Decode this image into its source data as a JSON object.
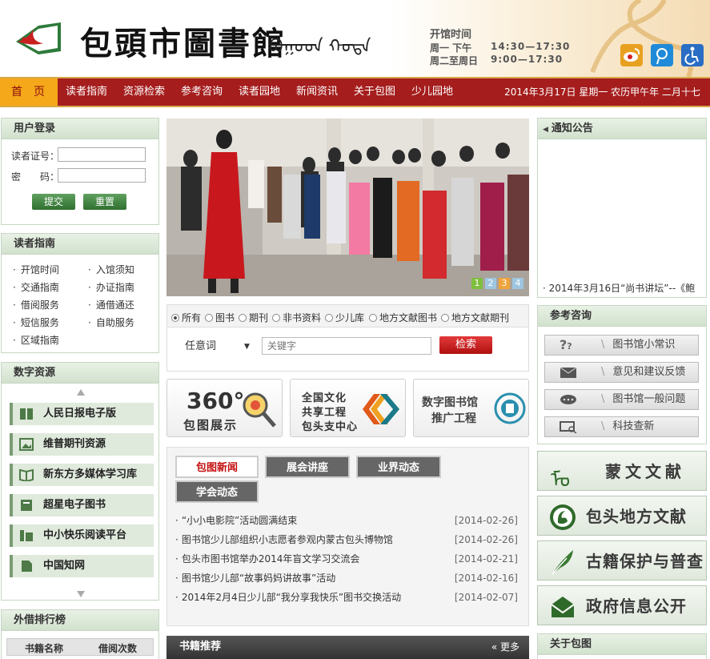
{
  "header": {
    "library_name": "包頭市圖書館",
    "mongolian_name": "ᠪᠣᠭᠣᠳ ᠬᠣᠲᠠ",
    "hours_title": "开馆时间",
    "hours": [
      {
        "days": "周一  下午",
        "time": "14:30—17:30"
      },
      {
        "days": "周二至周日",
        "time": "9:00—17:30"
      }
    ],
    "icons": [
      "weibo-icon",
      "tencent-weibo-icon",
      "accessibility-icon"
    ]
  },
  "nav": {
    "home": "首页",
    "items": [
      "读者指南",
      "资源检索",
      "参考咨询",
      "读者园地",
      "新闻资讯",
      "关于包图",
      "少儿园地"
    ],
    "date_text": "2014年3月17日  星期一  农历甲午年  二月十七"
  },
  "login": {
    "title": "用户登录",
    "card_label": "读者证号：",
    "password_label": "密　　码：",
    "submit": "提交",
    "reset": "重置"
  },
  "guide": {
    "title": "读者指南",
    "items": [
      "开馆时间",
      "入馆须知",
      "交通指南",
      "办证指南",
      "借阅服务",
      "通借通还",
      "短信服务",
      "自助服务",
      "区域指南"
    ]
  },
  "digital": {
    "title": "数字资源",
    "items": [
      "人民日报电子版",
      "维普期刊资源",
      "新东方多媒体学习库",
      "超星电子图书",
      "中小快乐阅读平台",
      "中国知网"
    ]
  },
  "ranking": {
    "title": "外借排行榜",
    "col_book": "书籍名称",
    "col_count": "借阅次数"
  },
  "banner": {
    "pages": [
      "1",
      "2",
      "3",
      "4"
    ]
  },
  "search": {
    "options": [
      "所有",
      "图书",
      "期刊",
      "非书资料",
      "少儿库",
      "地方文献图书",
      "地方文献期刊"
    ],
    "field_select": "任意词",
    "placeholder": "关键字",
    "button": "检索"
  },
  "promos": [
    {
      "line1": "360°",
      "line2": "包图展示"
    },
    {
      "line1": "全国文化",
      "line2": "共享工程",
      "line3": "包头支中心"
    },
    {
      "line1": "数字图书馆",
      "line2": "推广工程"
    }
  ],
  "news": {
    "tabs": [
      "包图新闻",
      "展会讲座",
      "业界动态",
      "学会动态"
    ],
    "items": [
      {
        "title": "“小小电影院”活动圆满结束",
        "date": "[2014-02-26]"
      },
      {
        "title": "图书馆少儿部组织小志愿者参观内蒙古包头博物馆",
        "date": "[2014-02-26]"
      },
      {
        "title": "包头市图书馆举办2014年盲文学习交流会",
        "date": "[2014-02-21]"
      },
      {
        "title": "图书馆少儿部“故事妈妈讲故事”活动",
        "date": "[2014-02-16]"
      },
      {
        "title": "2014年2月4日少儿部“我分享我快乐”图书交换活动",
        "date": "[2014-02-07]"
      }
    ]
  },
  "books": {
    "title": "书籍推荐",
    "more": "更多"
  },
  "notice": {
    "title": "通知公告",
    "scroll_text": "2014年3月16日“尚书讲坛”--《鲍"
  },
  "reference": {
    "title": "参考咨询",
    "items": [
      "图书馆小常识",
      "意见和建议反馈",
      "图书馆一般问题",
      "科技查新"
    ]
  },
  "features": [
    "蒙文文献",
    "包头地方文献",
    "古籍保护与普查",
    "政府信息公开"
  ],
  "about": {
    "title": "关于包图"
  }
}
